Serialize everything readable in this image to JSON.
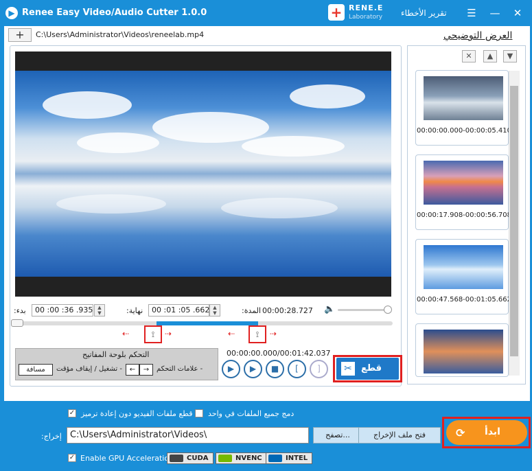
{
  "titlebar": {
    "app_title": "Renee Easy Video/Audio Cutter 1.0.0",
    "logo_brand": "RENE.E",
    "logo_sub": "Laboratory",
    "report_label": "تقرير الأخطاء",
    "menu_glyph": "☰",
    "minimize_glyph": "—",
    "close_glyph": "✕"
  },
  "file": {
    "add_glyph": "+",
    "path": "C:\\Users\\Administrator\\Videos\\reneelab.mp4"
  },
  "preview": {
    "label": "العرض التوضيحي"
  },
  "times": {
    "start_label": ":بدء",
    "start_value": "00 :00 :36 .935",
    "end_label": ":نهاية",
    "end_value": "00 :01 :05 .662",
    "duration_label": ":المدة",
    "duration_value": "00:00:28.727",
    "position": "00:00:00.000/00:01:42.037"
  },
  "keyboard": {
    "title": "التحكم بلوحة المفاتيح",
    "markers_label": "علامات التحكم -",
    "left_key": "←",
    "right_key": "→",
    "play_pause_label": "تشغيل / إيقاف مؤقت -",
    "space_key": "مسافة"
  },
  "cut": {
    "label": "قطع"
  },
  "thumbnails": [
    {
      "caption": "00:00:00.000-00:00:05.410"
    },
    {
      "caption": "00:00:17.908-00:00:56.708"
    },
    {
      "caption": "00:00:47.568-00:01:05.662"
    },
    {
      "caption": ""
    }
  ],
  "options": {
    "merge_label": "دمج جميع الملفات في واحد",
    "merge_checked": false,
    "cut_no_reencode_label": "قطع ملفات الفيديو دون إعادة ترميز",
    "cut_no_reencode_checked": true,
    "output_label": ":إخراج",
    "output_path": "C:\\Users\\Administrator\\Videos\\",
    "browse_label": "تصفح...",
    "open_folder_label": "فتح ملف الإخراج",
    "gpu_label": "Enable GPU Acceleration",
    "gpu_checked": true,
    "gpu_options": [
      "CUDA",
      "NVENC",
      "INTEL"
    ]
  },
  "start": {
    "label": "ابدأ"
  },
  "colors": {
    "accent": "#1a8fd8",
    "start": "#f7941d",
    "highlight": "#e02020"
  }
}
